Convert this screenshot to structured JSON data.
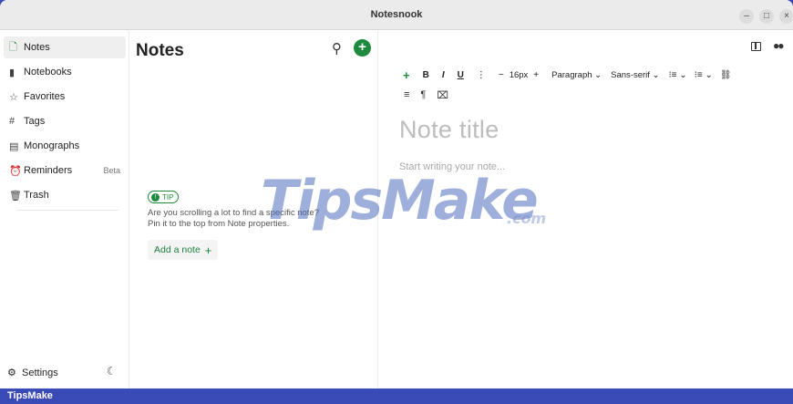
{
  "window": {
    "title": "Notesnook"
  },
  "sidebar": {
    "items": [
      {
        "label": "Notes",
        "icon": "note-icon",
        "glyph": "🗋",
        "active": true
      },
      {
        "label": "Notebooks",
        "icon": "notebook-icon",
        "glyph": "▮"
      },
      {
        "label": "Favorites",
        "icon": "star-icon",
        "glyph": "☆"
      },
      {
        "label": "Tags",
        "icon": "hash-icon",
        "glyph": "#"
      },
      {
        "label": "Monographs",
        "icon": "monograph-icon",
        "glyph": "▤"
      },
      {
        "label": "Reminders",
        "icon": "alarm-icon",
        "glyph": "⏰",
        "badge": "Beta"
      },
      {
        "label": "Trash",
        "icon": "trash-icon",
        "glyph": "🗑"
      }
    ],
    "settings_label": "Settings"
  },
  "list": {
    "title": "Notes",
    "tip_badge": "TIP",
    "tip_text": "Are you scrolling a lot to find a specific note? Pin it to the top from Note properties.",
    "add_note_label": "Add a note"
  },
  "editor": {
    "toolbar": {
      "bold": "B",
      "italic": "I",
      "underline": "U",
      "more": "⋮",
      "decrease": "−",
      "font_size": "16px",
      "increase": "+",
      "block_type": "Paragraph",
      "font_family": "Sans-serif",
      "ordered_list": "⁝≡",
      "bullet_list": "⁝≡",
      "link": "⛓"
    },
    "title_placeholder": "Note title",
    "body_placeholder": "Start writing your note..."
  },
  "watermark": {
    "main": "TipsMake",
    "suffix": ".com"
  },
  "brand_bar": {
    "label": "TipsMake"
  },
  "colors": {
    "accent": "#1d8a3d",
    "brand_bar": "#3a4ab7"
  }
}
